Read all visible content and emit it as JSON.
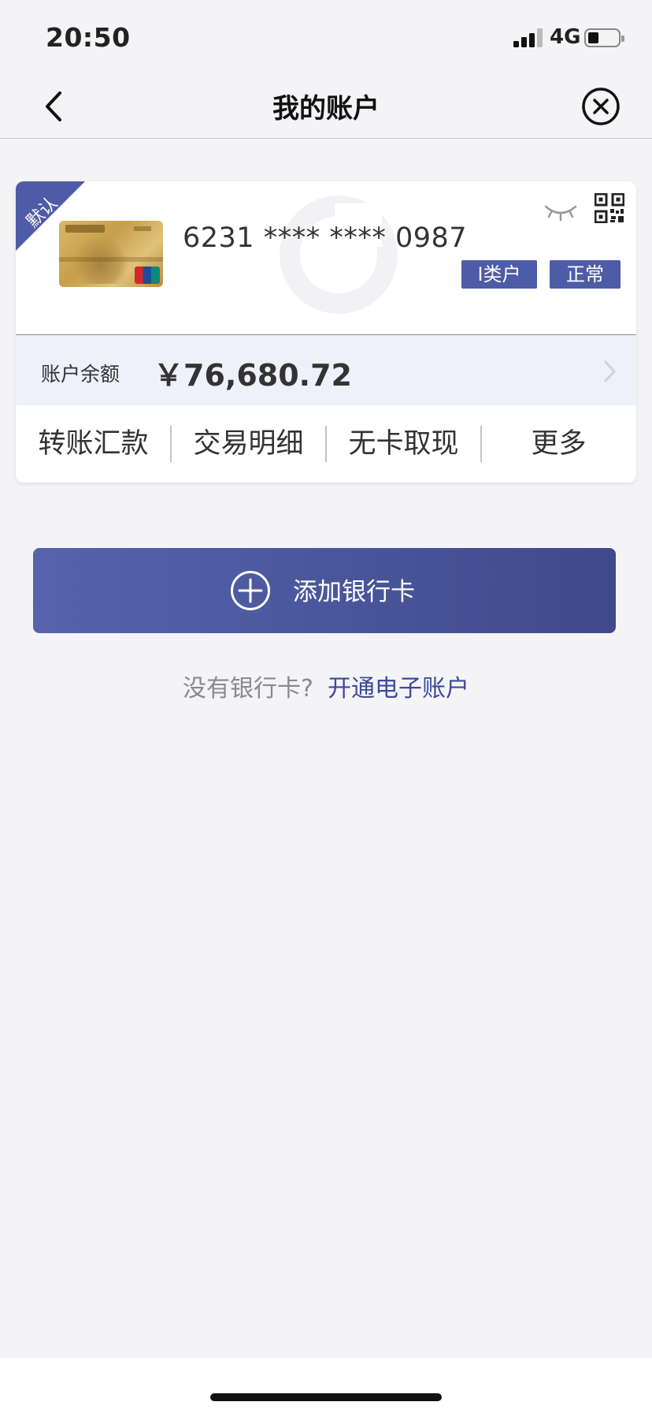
{
  "status_bar": {
    "time": "20:50",
    "network": "4G",
    "icons": [
      "signal-icon",
      "battery-icon"
    ]
  },
  "nav": {
    "title": "我的账户",
    "back_icon": "chevron-left-icon",
    "close_icon": "close-circle-icon"
  },
  "account_card": {
    "default_label": "默认",
    "card_number": "6231 **** **** 0987",
    "account_type": "I类户",
    "status": "正常",
    "icons": [
      "eye-closed-icon",
      "qr-code-icon"
    ],
    "balance_label": "账户余额",
    "balance": "￥76,680.72",
    "actions": [
      {
        "label": "转账汇款"
      },
      {
        "label": "交易明细"
      },
      {
        "label": "无卡取现"
      },
      {
        "label": "更多"
      }
    ]
  },
  "add_card": {
    "label": "添加银行卡",
    "icon": "plus-circle-icon"
  },
  "open_account": {
    "question": "没有银行卡?",
    "link": "开通电子账户"
  },
  "colors": {
    "accent": "#4e5ba6",
    "link": "#3d4a9c",
    "background": "#f4f4f6"
  }
}
